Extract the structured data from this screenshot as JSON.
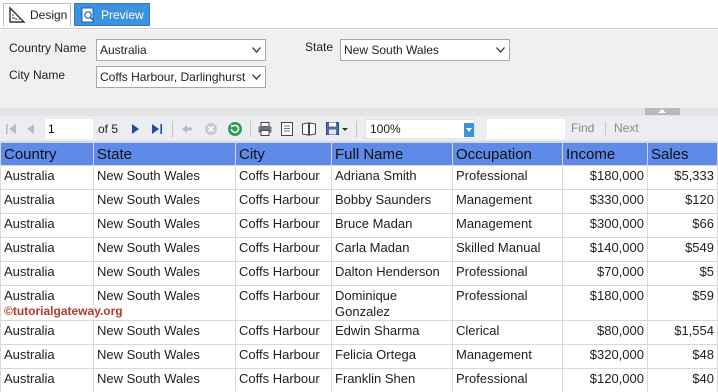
{
  "tabs": {
    "design": "Design",
    "preview": "Preview"
  },
  "parameters": {
    "country_label": "Country Name",
    "country_value": "Australia",
    "state_label": "State",
    "state_value": "New South Wales",
    "city_label": "City Name",
    "city_value": "Coffs Harbour, Darlinghurst"
  },
  "toolbar": {
    "page_current": "1",
    "page_of": "of  5",
    "zoom": "100%",
    "find": "Find",
    "next": "Next"
  },
  "table": {
    "columns": [
      "Country",
      "State",
      "City",
      "Full Name",
      "Occupation",
      "Income",
      "Sales"
    ],
    "rows": [
      [
        "Australia",
        "New South Wales",
        "Coffs Harbour",
        "Adriana Smith",
        "Professional",
        "$180,000",
        "$5,333"
      ],
      [
        "Australia",
        "New South Wales",
        "Coffs Harbour",
        "Bobby Saunders",
        "Management",
        "$330,000",
        "$120"
      ],
      [
        "Australia",
        "New South Wales",
        "Coffs Harbour",
        "Bruce Madan",
        "Management",
        "$300,000",
        "$66"
      ],
      [
        "Australia",
        "New South Wales",
        "Coffs Harbour",
        "Carla Madan",
        "Skilled Manual",
        "$140,000",
        "$549"
      ],
      [
        "Australia",
        "New South Wales",
        "Coffs Harbour",
        "Dalton Henderson",
        "Professional",
        "$70,000",
        "$5"
      ],
      [
        "Australia",
        "New South Wales",
        "Coffs Harbour",
        "Dominique Gonzalez",
        "Professional",
        "$180,000",
        "$59"
      ],
      [
        "Australia",
        "New South Wales",
        "Coffs Harbour",
        "Edwin Sharma",
        "Clerical",
        "$80,000",
        "$1,554"
      ],
      [
        "Australia",
        "New South Wales",
        "Coffs Harbour",
        "Felicia Ortega",
        "Management",
        "$320,000",
        "$48"
      ],
      [
        "Australia",
        "New South Wales",
        "Coffs Harbour",
        "Franklin Shen",
        "Professional",
        "$120,000",
        "$40"
      ]
    ]
  },
  "watermark": "©tutorialgateway.org",
  "colors": {
    "header_bg": "#5f8ae8",
    "preview_tab": "#3c92de",
    "watermark": "#b03a2e"
  }
}
